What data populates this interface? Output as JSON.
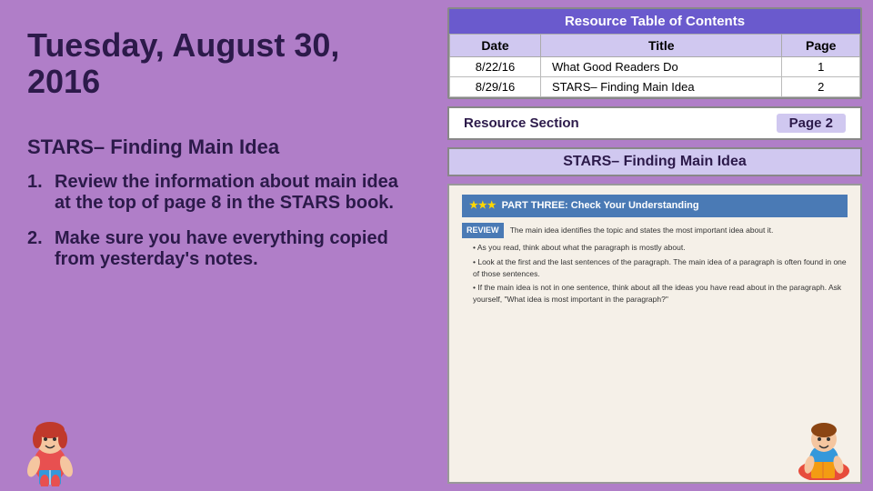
{
  "left": {
    "date_title": "Tuesday, August 30, 2016",
    "section_heading": "STARS– Finding Main Idea",
    "instructions": [
      {
        "num": "1.",
        "text": "Review the information about main idea at the top of page 8 in the STARS book."
      },
      {
        "num": "2.",
        "text": "Make sure you have everything copied from yesterday's notes."
      }
    ]
  },
  "right": {
    "toc": {
      "title": "Resource Table of Contents",
      "headers": [
        "Date",
        "Title",
        "Page"
      ],
      "rows": [
        {
          "date": "8/22/16",
          "title": "What Good Readers Do",
          "page": "1"
        },
        {
          "date": "8/29/16",
          "title": "STARS– Finding Main Idea",
          "page": "2"
        }
      ]
    },
    "resource_section": {
      "label": "Resource Section",
      "page_label": "Page 2"
    },
    "stars_header": "STARS– Finding Main Idea",
    "book": {
      "part_header": "PART THREE: Check Your Understanding",
      "review_label": "REVIEW",
      "lines": [
        "The main idea identifies the topic and states the most important idea about it.",
        "As you read, think about what the paragraph is mostly about.",
        "Look at the first and the last sentences of the paragraph. The main idea of a paragraph is often found in one of those sentences.",
        "If the main idea is not in one sentence, think about all the ideas you have read about in the paragraph. Ask yourself, \"What idea is most important in the paragraph?\""
      ]
    }
  }
}
